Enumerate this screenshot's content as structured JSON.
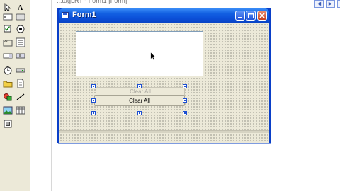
{
  "designer": {
    "title_fragment": "...tagLRT - Form1 [Form]",
    "tabs": [
      "◄",
      "►",
      "×"
    ]
  },
  "toolbox": {
    "icons": [
      "pointer-icon",
      "label-icon",
      "textbox-icon",
      "button-icon",
      "checkbox-icon",
      "radio-button-icon",
      "groupbox-icon",
      "listbox-icon",
      "combobox-icon",
      "scrollbar-icon",
      "timer-icon",
      "drive-list-icon",
      "folder-icon",
      "file-list-icon",
      "shape-icon",
      "line-icon",
      "image-icon",
      "data-icon",
      "ole-icon"
    ]
  },
  "form": {
    "title": "Form1",
    "textbox_value": "",
    "buttons": {
      "back_label": "Clear All",
      "front_label": "Clear All"
    }
  },
  "colors": {
    "titlebar": "#0b4fd8",
    "client_background": "#ece9d8",
    "selection_handle": "#1c4fd1",
    "close_button": "#c8411f"
  }
}
